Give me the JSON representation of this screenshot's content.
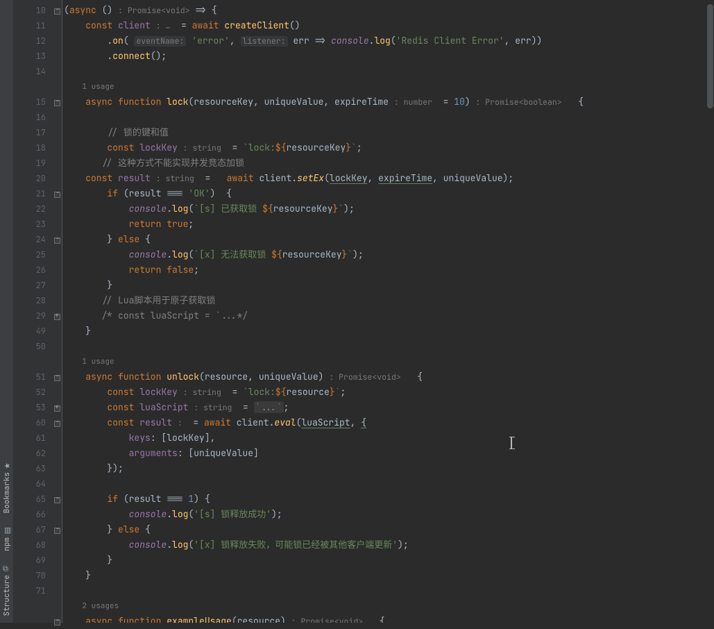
{
  "toolwindows": [
    {
      "label": "Bookmarks",
      "icon": "★"
    },
    {
      "label": "npm",
      "icon": "▤"
    },
    {
      "label": "Structure",
      "icon": "⧉"
    }
  ],
  "usages": {
    "lock": "1 usage",
    "unlock": "1 usage",
    "exampleUsage": "2 usages"
  },
  "lines": [
    {
      "n": 10,
      "fold": "minus",
      "html": "<span class='def'>(</span><span class='kw'>async </span><span class='def'>()</span> <span class='hintp'>: Promise&lt;void&gt;</span> <span class='def'>=&gt; {</span>"
    },
    {
      "n": 11,
      "html": "    <span class='kw'>const </span><span class='var'>client</span> <span class='hintp'>: …</span>  <span class='def'>= </span><span class='kw'>await </span><span class='meth'>createClient</span><span class='def'>()</span>"
    },
    {
      "n": 12,
      "html": "        <span class='def'>.</span><span class='meth'>on</span><span class='def'>(</span> <span class='hint'>eventName:</span> <span class='str'>'error'</span><span class='def'>,</span> <span class='hint'>listener:</span> <span class='def'>err =&gt; </span><span class='obj'>console</span><span class='def'>.</span><span class='meth'>log</span><span class='def'>(</span><span class='str'>'Redis Client Error'</span><span class='def'>, err))</span>"
    },
    {
      "n": 13,
      "html": "        <span class='def'>.</span><span class='meth'>connect</span><span class='def'>();</span>"
    },
    {
      "n": 14,
      "html": ""
    },
    {
      "usage": "lock",
      "indent": "    "
    },
    {
      "n": 15,
      "fold": "minus",
      "html": "    <span class='kw'>async function </span><span class='fn'>lock</span><span class='def'>(resourceKey, uniqueValue, expireTime</span> <span class='hintp'>: number</span>  <span class='def'>= </span><span class='num'>10</span><span class='def'>)</span> <span class='hintp'>: Promise&lt;boolean&gt;</span>   <span class='def'>{</span>"
    },
    {
      "n": 16,
      "html": ""
    },
    {
      "n": 17,
      "html": "        <span class='cmnt'>// </span><span class='cmnt'>锁的键和值</span>"
    },
    {
      "n": 18,
      "html": "        <span class='kw'>const </span><span class='var'>lockKey</span> <span class='hintp'>: string</span>  <span class='def'>= </span><span class='str'>`lock:</span><span class='kw'>${</span><span class='def'>resourceKey</span><span class='kw'>}</span><span class='str'>`</span><span class='def'>;</span>"
    },
    {
      "n": 19,
      "html": "       <span class='cmnt'>// </span><span class='cmnt'>这种方式不能实现并发竞态加锁</span>"
    },
    {
      "n": 20,
      "html": "    <span class='kw'>const </span><span class='var'>result</span> <span class='hintp'>: string</span>  <span class='def'>=   </span><span class='kw'>await </span><span class='def'>client.</span><span class='mit'>setEx</span><span class='def'>(</span><span class='param'>lockKey</span><span class='def'>, </span><span class='param'>expireTime</span><span class='def'>, uniqueValue);</span>"
    },
    {
      "n": 21,
      "fold": "minus",
      "html": "        <span class='kw'>if </span><span class='def'>(result === </span><span class='str'>'OK'</span><span class='def'>)  {</span>"
    },
    {
      "n": 22,
      "html": "            <span class='obj'>console</span><span class='def'>.</span><span class='meth'>log</span><span class='def'>(</span><span class='str'>`[s] </span><span class='str'>已获取锁</span><span class='str'> </span><span class='kw'>${</span><span class='def'>resourceKey</span><span class='kw'>}</span><span class='str'>`</span><span class='def'>);</span>"
    },
    {
      "n": 23,
      "html": "            <span class='kw'>return true</span><span class='def'>;</span>"
    },
    {
      "n": 24,
      "fold": "minus",
      "html": "        <span class='def'>} </span><span class='kw'>else </span><span class='def'>{</span>"
    },
    {
      "n": 25,
      "html": "            <span class='obj'>console</span><span class='def'>.</span><span class='meth'>log</span><span class='def'>(</span><span class='str'>`[x] </span><span class='str'>无法获取锁</span><span class='str'> </span><span class='kw'>${</span><span class='def'>resourceKey</span><span class='kw'>}</span><span class='str'>`</span><span class='def'>);</span>"
    },
    {
      "n": 26,
      "html": "            <span class='kw'>return false</span><span class='def'>;</span>"
    },
    {
      "n": 27,
      "fold": "bar",
      "html": "        <span class='def'>}</span>"
    },
    {
      "n": 28,
      "html": "       <span class='cmnt'>// Lua脚本用于原子获取锁</span>"
    },
    {
      "n": 29,
      "fold": "plus",
      "html": "       <span class='cmnt'>/* const luaScript = `...*/</span>"
    },
    {
      "n": 49,
      "fold": "bar",
      "html": "    <span class='def'>}</span>"
    },
    {
      "n": 50,
      "html": ""
    },
    {
      "usage": "unlock",
      "indent": "    "
    },
    {
      "n": 51,
      "fold": "minus",
      "html": "    <span class='kw'>async function </span><span class='fn'>unlock</span><span class='def'>(resource, uniqueValue)</span> <span class='hintp'>: Promise&lt;void&gt;</span>   <span class='def'>{</span>"
    },
    {
      "n": 52,
      "html": "        <span class='kw'>const </span><span class='var'>lockKey</span> <span class='hintp'>: string</span>  <span class='def'>= </span><span class='str'>`lock:</span><span class='kw'>${</span><span class='def'>resource</span><span class='kw'>}</span><span class='str'>`</span><span class='def'>;</span>"
    },
    {
      "n": 53,
      "fold": "plus",
      "html": "        <span class='kw'>const </span><span class='var'>luaScript</span> <span class='hintp'>: string</span>  <span class='def'>= </span><span class='fold-ph'>`...`</span><span class='def'>;</span>"
    },
    {
      "n": 60,
      "fold": "minus",
      "html": "        <span class='kw'>const </span><span class='var'>result</span> <span class='hintp'>:</span>  <span class='def'>= </span><span class='kw'>await </span><span class='def'>client.</span><span class='mit'>eval</span><span class='def'>(</span><span class='param'>luaScript</span><span class='def'>, </span><span class='param'>{</span>"
    },
    {
      "n": 61,
      "html": "            <span class='var'>keys</span><span class='def'>: [lockKey],</span>"
    },
    {
      "n": 62,
      "html": "            <span class='var'>arguments</span><span class='def'>: [uniqueValue]</span>"
    },
    {
      "n": 63,
      "fold": "bar",
      "html": "        <span class='def'>});</span>"
    },
    {
      "n": 64,
      "html": ""
    },
    {
      "n": 65,
      "fold": "minus",
      "html": "        <span class='kw'>if </span><span class='def'>(result === </span><span class='num'>1</span><span class='def'>) {</span>"
    },
    {
      "n": 66,
      "html": "            <span class='obj'>console</span><span class='def'>.</span><span class='meth'>log</span><span class='def'>(</span><span class='str'>'[s] 锁释放成功'</span><span class='def'>);</span>"
    },
    {
      "n": 67,
      "fold": "minus",
      "html": "        <span class='def'>} </span><span class='kw'>else </span><span class='def'>{</span>"
    },
    {
      "n": 68,
      "html": "            <span class='obj'>console</span><span class='def'>.</span><span class='meth'>log</span><span class='def'>(</span><span class='str'>'[x] 锁释放失败，可能锁已经被其他客户端更新'</span><span class='def'>);</span>"
    },
    {
      "n": 69,
      "fold": "bar",
      "html": "        <span class='def'>}</span>"
    },
    {
      "n": 70,
      "fold": "bar",
      "html": "    <span class='def'>}</span>"
    },
    {
      "n": 71,
      "html": ""
    },
    {
      "usage": "exampleUsage",
      "indent": "    "
    },
    {
      "n": "",
      "fold": "minus",
      "html": "    <span class='kw'>async function </span><span class='fn'>exampleUsage</span><span class='def'>(resource)</span> <span class='hintp'>: Promise&lt;void&gt;</span>   <span class='def'>{</span>"
    }
  ]
}
